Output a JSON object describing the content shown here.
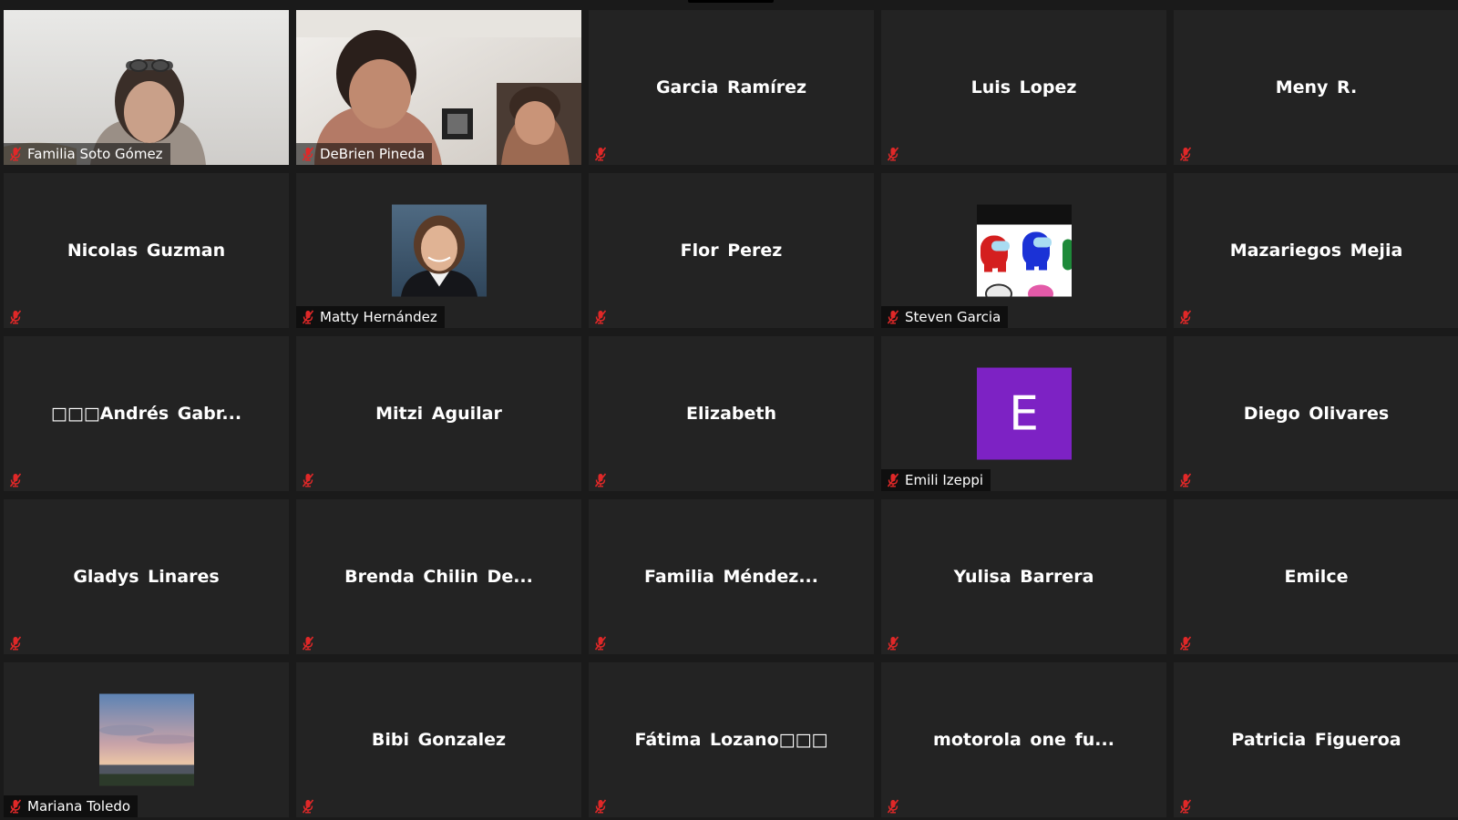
{
  "meeting": {
    "colors": {
      "background": "#1a1a1a",
      "tile": "#232323",
      "mic_muted": "#e02828",
      "avatar_purple": "#7d22c4"
    },
    "participants": [
      {
        "name": "Familia Soto Gómez",
        "display": "video",
        "muted": true
      },
      {
        "name": "DeBrien Pineda",
        "display": "video",
        "muted": true
      },
      {
        "name": "Garcia Ramírez",
        "display": "name",
        "muted": true
      },
      {
        "name": "Luis Lopez",
        "display": "name",
        "muted": true
      },
      {
        "name": "Meny R.",
        "display": "name",
        "muted": true
      },
      {
        "name": "Nicolas Guzman",
        "display": "name",
        "muted": true
      },
      {
        "name": "Matty Hernández",
        "display": "photo",
        "muted": true
      },
      {
        "name": "Flor Perez",
        "display": "name",
        "muted": true
      },
      {
        "name": "Steven Garcia",
        "display": "photo",
        "muted": true
      },
      {
        "name": "Mazariegos Mejia",
        "display": "name",
        "muted": true
      },
      {
        "name": "□□□Andrés Gabr...",
        "display": "name",
        "muted": true
      },
      {
        "name": "Mitzi Aguilar",
        "display": "name",
        "muted": true
      },
      {
        "name": "Elizabeth",
        "display": "name",
        "muted": true
      },
      {
        "name": "Emili Izeppi",
        "display": "letter-avatar",
        "avatar_letter": "E",
        "muted": true
      },
      {
        "name": "Diego Olivares",
        "display": "name",
        "muted": true
      },
      {
        "name": "Gladys Linares",
        "display": "name",
        "muted": true
      },
      {
        "name": "Brenda Chilin De...",
        "display": "name",
        "muted": true
      },
      {
        "name": "Familia Méndez...",
        "display": "name",
        "muted": true
      },
      {
        "name": "Yulisa Barrera",
        "display": "name",
        "muted": true
      },
      {
        "name": "Emilce",
        "display": "name",
        "muted": true
      },
      {
        "name": "Mariana Toledo",
        "display": "photo",
        "muted": true
      },
      {
        "name": "Bibi Gonzalez",
        "display": "name",
        "muted": true
      },
      {
        "name": "Fátima Lozano□□□",
        "display": "name",
        "muted": true
      },
      {
        "name": "motorola one fu...",
        "display": "name",
        "muted": true
      },
      {
        "name": "Patricia Figueroa",
        "display": "name",
        "muted": true
      }
    ]
  }
}
